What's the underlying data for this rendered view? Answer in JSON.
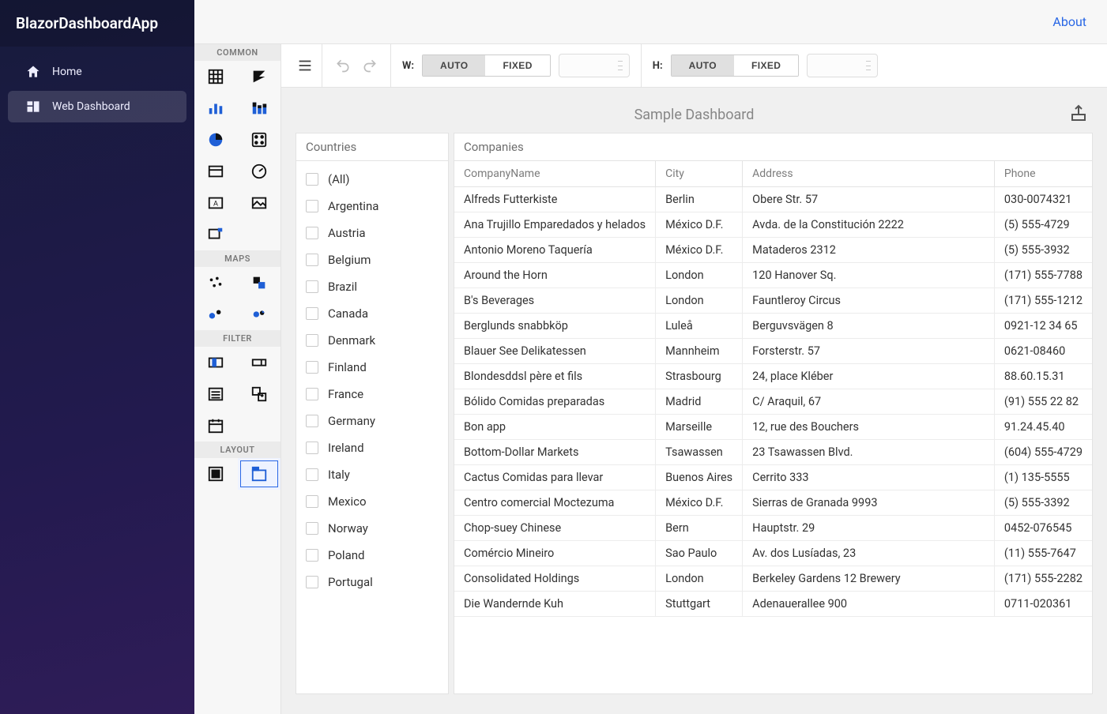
{
  "brand": "BlazorDashboardApp",
  "nav": {
    "home": "Home",
    "web_dashboard": "Web Dashboard"
  },
  "topbar": {
    "about": "About"
  },
  "toolbar": {
    "w_label": "W:",
    "h_label": "H:",
    "auto": "AUTO",
    "fixed": "FIXED"
  },
  "toolbox": {
    "groups": {
      "common": "COMMON",
      "maps": "MAPS",
      "filter": "FILTER",
      "layout": "LAYOUT"
    }
  },
  "dashboard": {
    "title": "Sample Dashboard"
  },
  "countries": {
    "title": "Countries",
    "items": [
      "(All)",
      "Argentina",
      "Austria",
      "Belgium",
      "Brazil",
      "Canada",
      "Denmark",
      "Finland",
      "France",
      "Germany",
      "Ireland",
      "Italy",
      "Mexico",
      "Norway",
      "Poland",
      "Portugal"
    ]
  },
  "companies": {
    "title": "Companies",
    "columns": [
      "CompanyName",
      "City",
      "Address",
      "Phone"
    ],
    "rows": [
      {
        "name": "Alfreds Futterkiste",
        "city": "Berlin",
        "address": "Obere Str. 57",
        "phone": "030-0074321"
      },
      {
        "name": "Ana Trujillo Emparedados y helados",
        "city": "México D.F.",
        "address": "Avda. de la Constitución 2222",
        "phone": "(5) 555-4729"
      },
      {
        "name": "Antonio Moreno Taquería",
        "city": "México D.F.",
        "address": "Mataderos 2312",
        "phone": "(5) 555-3932"
      },
      {
        "name": "Around the Horn",
        "city": "London",
        "address": "120 Hanover Sq.",
        "phone": "(171) 555-7788"
      },
      {
        "name": "B's Beverages",
        "city": "London",
        "address": "Fauntleroy Circus",
        "phone": "(171) 555-1212"
      },
      {
        "name": "Berglunds snabbköp",
        "city": "Luleå",
        "address": "Berguvsvägen 8",
        "phone": "0921-12 34 65"
      },
      {
        "name": "Blauer See Delikatessen",
        "city": "Mannheim",
        "address": "Forsterstr. 57",
        "phone": "0621-08460"
      },
      {
        "name": "Blondesddsl père et fils",
        "city": "Strasbourg",
        "address": "24, place Kléber",
        "phone": "88.60.15.31"
      },
      {
        "name": "Bólido Comidas preparadas",
        "city": "Madrid",
        "address": "C/ Araquil, 67",
        "phone": "(91) 555 22 82"
      },
      {
        "name": "Bon app",
        "city": "Marseille",
        "address": "12, rue des Bouchers",
        "phone": "91.24.45.40"
      },
      {
        "name": "Bottom-Dollar Markets",
        "city": "Tsawassen",
        "address": "23 Tsawassen Blvd.",
        "phone": "(604) 555-4729"
      },
      {
        "name": "Cactus Comidas para llevar",
        "city": "Buenos Aires",
        "address": "Cerrito 333",
        "phone": "(1) 135-5555"
      },
      {
        "name": "Centro comercial Moctezuma",
        "city": "México D.F.",
        "address": "Sierras de Granada 9993",
        "phone": "(5) 555-3392"
      },
      {
        "name": "Chop-suey Chinese",
        "city": "Bern",
        "address": "Hauptstr. 29",
        "phone": "0452-076545"
      },
      {
        "name": "Comércio Mineiro",
        "city": "Sao Paulo",
        "address": "Av. dos Lusíadas, 23",
        "phone": "(11) 555-7647"
      },
      {
        "name": "Consolidated Holdings",
        "city": "London",
        "address": "Berkeley Gardens 12 Brewery",
        "phone": "(171) 555-2282"
      },
      {
        "name": "Die Wandernde Kuh",
        "city": "Stuttgart",
        "address": "Adenauerallee 900",
        "phone": "0711-020361"
      }
    ]
  }
}
